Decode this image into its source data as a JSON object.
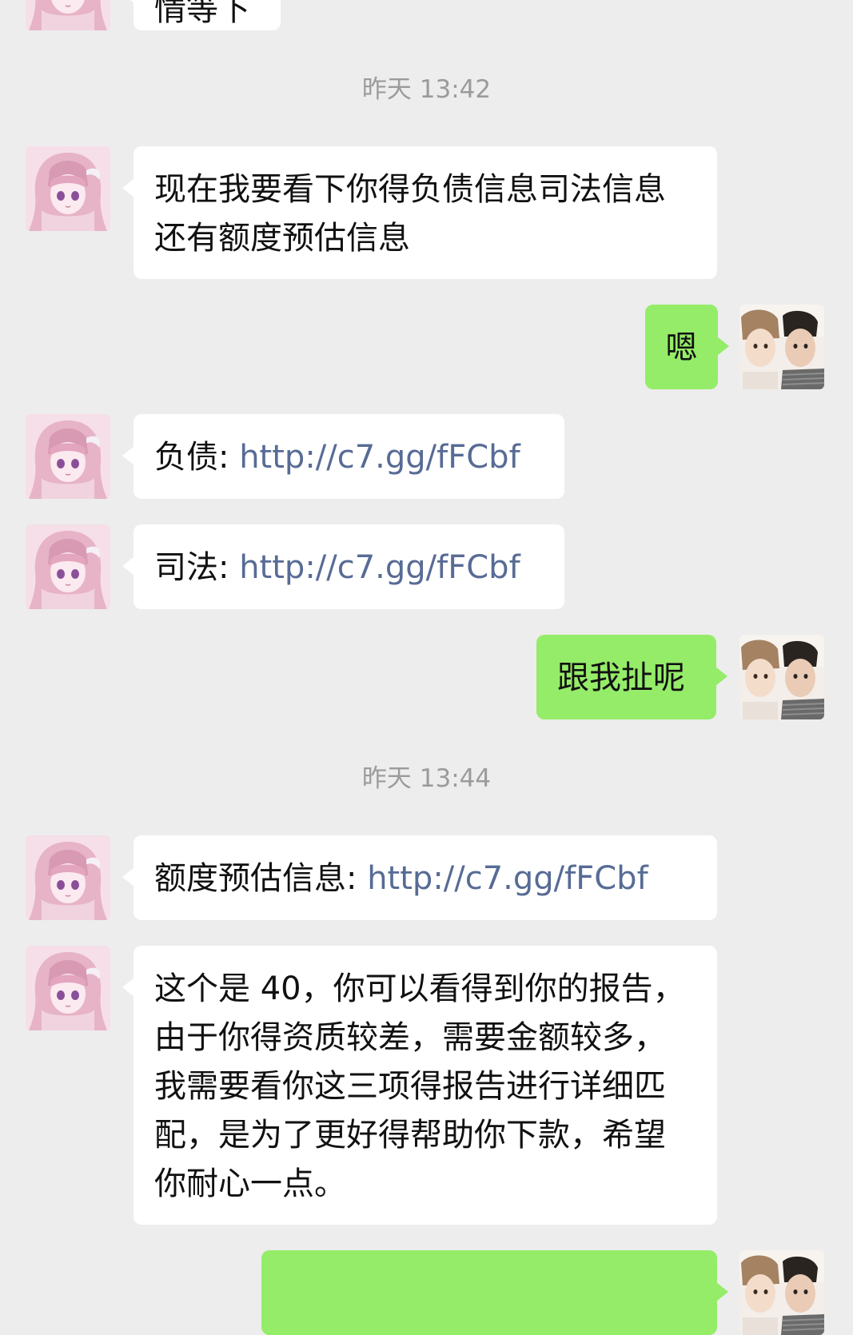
{
  "chat": {
    "partial_top_text": "情等下",
    "timestamps": [
      "昨天 13:42",
      "昨天 13:44"
    ],
    "messages": [
      {
        "side": "left",
        "text": "现在我要看下你得负债信息司法信息还有额度预估信息"
      },
      {
        "side": "right",
        "text": "嗯"
      },
      {
        "side": "left",
        "label": "负债: ",
        "link": "http://c7.gg/fFCbf"
      },
      {
        "side": "left",
        "label": "司法: ",
        "link": "http://c7.gg/fFCbf"
      },
      {
        "side": "right",
        "text": "跟我扯呢"
      },
      {
        "side": "left",
        "label": "额度预估信息: ",
        "link": "http://c7.gg/fFCbf"
      },
      {
        "side": "left",
        "text": "这个是 40，你可以看得到你的报告，由于你得资质较差，需要金额较多，我需要看你这三项得报告进行详细匹配，是为了更好得帮助你下款，希望你耐心一点。"
      }
    ]
  },
  "colors": {
    "background": "#ededed",
    "bubble_received": "#ffffff",
    "bubble_sent": "#95ec69",
    "link": "#576b95",
    "timestamp": "#9b9b9b"
  },
  "icons": {
    "contact_avatar": "anime-girl-avatar",
    "self_avatar": "couple-photo-avatar"
  }
}
